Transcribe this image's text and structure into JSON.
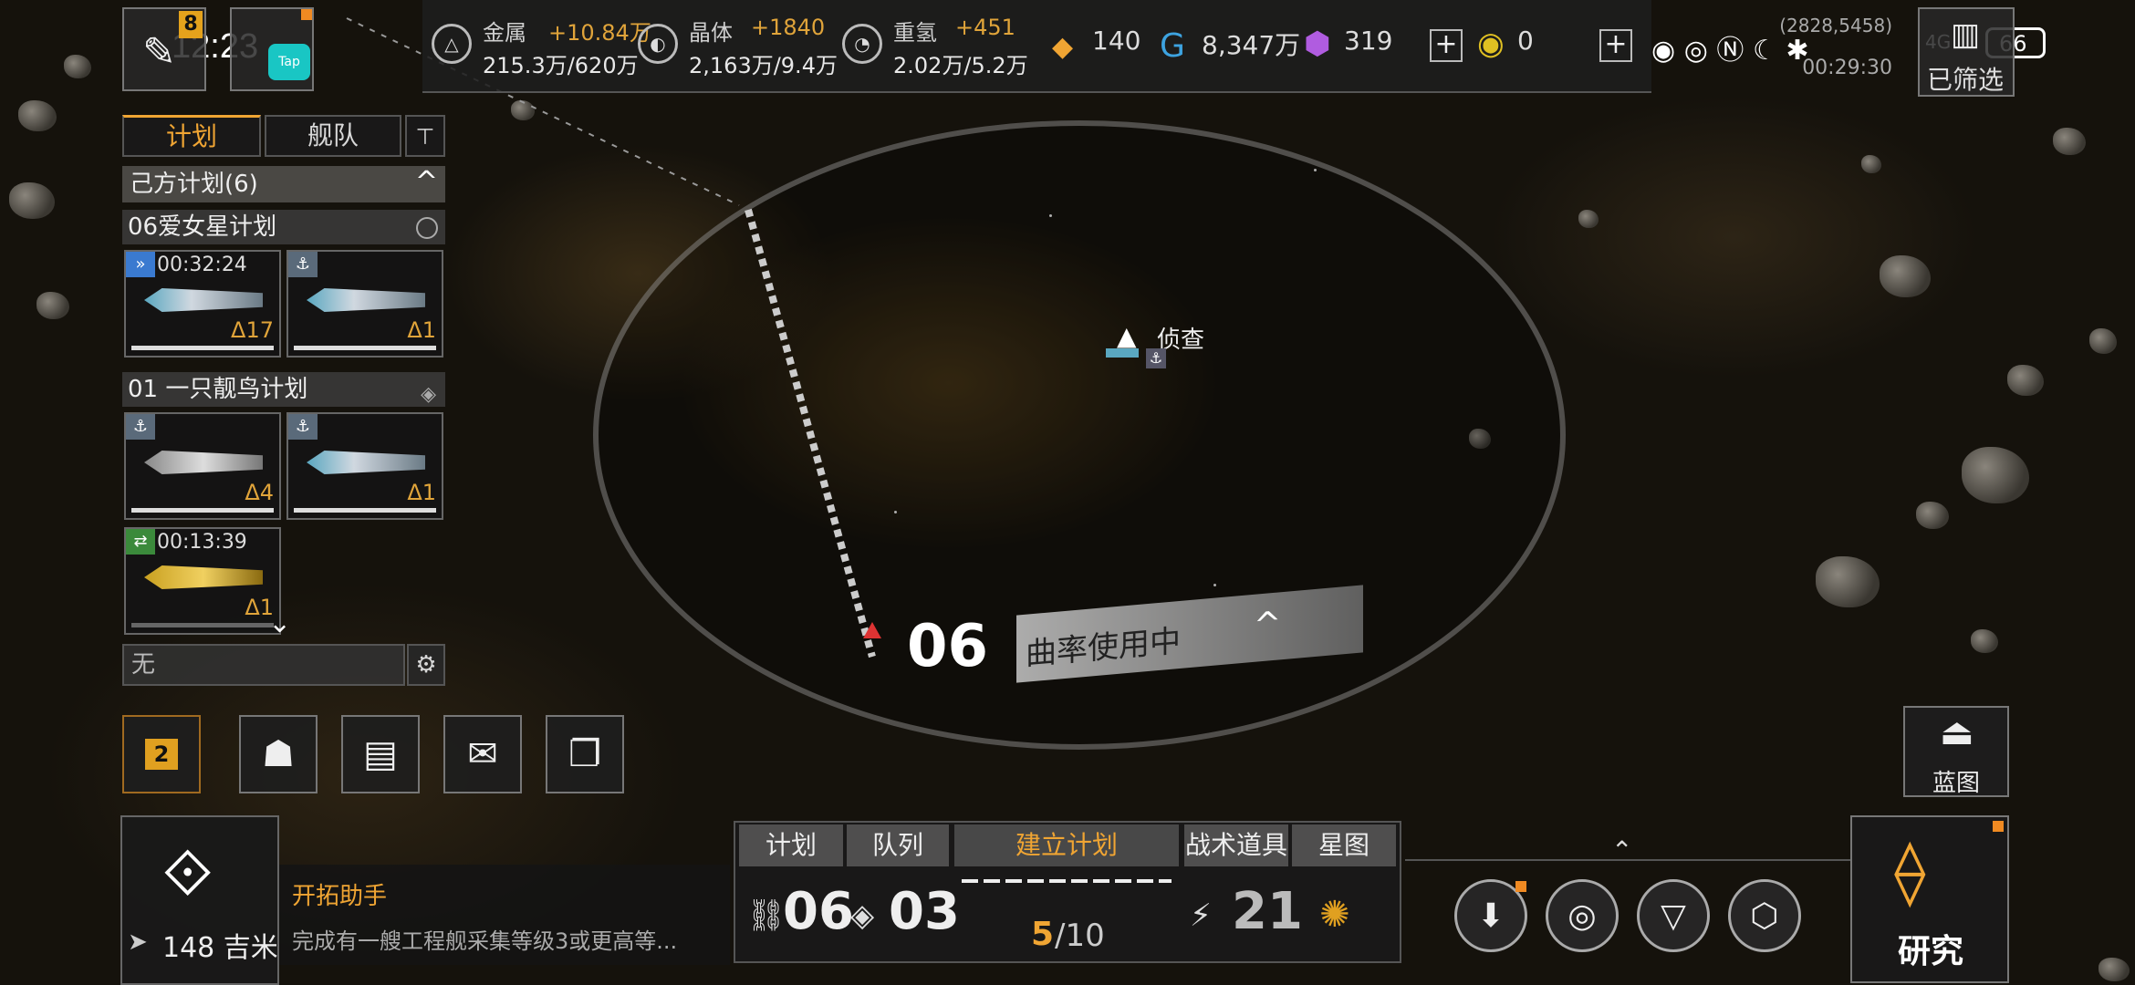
{
  "status_bar": {
    "time": "12:23",
    "battery": "66",
    "network": "4G"
  },
  "topleft": {
    "badge": "8",
    "tap_label": "Tap"
  },
  "resources": [
    {
      "name": "金属",
      "gain": "+10.84万",
      "amount": "215.3万/620万",
      "icon": "metal-icon"
    },
    {
      "name": "晶体",
      "gain": "+1840",
      "amount": "2,163万/9.4万",
      "icon": "crystal-icon"
    },
    {
      "name": "重氢",
      "gain": "+451",
      "amount": "2.02万/5.2万",
      "icon": "deuterium-icon"
    }
  ],
  "currencies": {
    "fuel": "140",
    "credits": "8,347万",
    "gems": "319",
    "tokens": "0"
  },
  "coordinates": "(2828,5458)",
  "coord_sub": "00:29:30",
  "filter_status": "已筛选",
  "left_panel": {
    "tabs": [
      "计划",
      "舰队"
    ],
    "own_plans_header": "己方计划(6)",
    "plans": [
      {
        "title": "06爱女星计划",
        "ships": [
          {
            "timer": "00:32:24",
            "level": "Δ17"
          },
          {
            "timer": "",
            "level": "Δ1"
          }
        ]
      },
      {
        "title": "01 一只靓鸟计划",
        "ships": [
          {
            "timer": "",
            "level": "Δ4"
          },
          {
            "timer": "",
            "level": "Δ1"
          },
          {
            "timer": "00:13:39",
            "level": "Δ1"
          }
        ]
      }
    ],
    "filter_input": "无"
  },
  "quick_badge": "2",
  "map": {
    "scout_label": "侦查",
    "plan_number": "06",
    "plan_status": "曲率使用中"
  },
  "blueprint_label": "蓝图",
  "assistant": {
    "distance": "148 吉米",
    "title": "开拓助手",
    "desc": "完成有一艘工程舰采集等级3或更高等..."
  },
  "bottom_tabs": {
    "plan": "计划",
    "queue": "队列",
    "build_plan": "建立计划",
    "tactics": "战术道具",
    "starmap": "星图"
  },
  "bottom_values": {
    "plan_count": "06",
    "queue_count": "03",
    "build_progress_current": "5",
    "build_progress_total": "/10",
    "tactics_count": "21"
  },
  "research_label": "研究",
  "colors": {
    "accent": "#f0a533",
    "panel": "#1e1e1e",
    "text": "#d8d8d8"
  }
}
